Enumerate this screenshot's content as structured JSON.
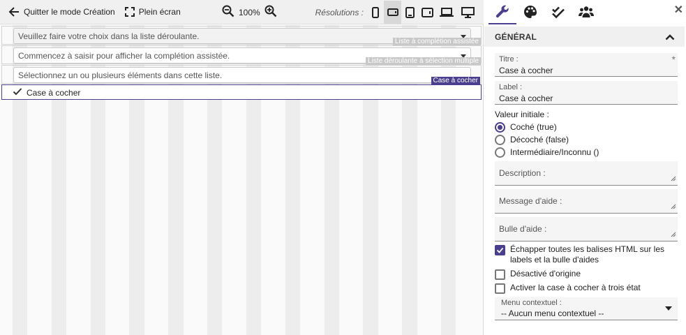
{
  "toolbar": {
    "quit_label": "Quitter le mode Création",
    "fullscreen_label": "Plein écran",
    "zoom_value": "100%",
    "resolutions_label": "Résolutions :"
  },
  "canvas": {
    "rows": [
      {
        "text": "Veuillez faire votre choix dans la liste déroulante.",
        "tag": "Liste à complétion assistée"
      },
      {
        "text": "Commencez à saisir pour afficher la complétion assistée.",
        "tag": "Liste déroulante à sélection multiple"
      },
      {
        "text": "Sélectionnez un ou plusieurs éléments dans cette liste.",
        "tag": ""
      }
    ],
    "checkbox": {
      "label": "Case à cocher",
      "tag": "Case à cocher",
      "checked": true
    }
  },
  "panel": {
    "section_title": "GÉNÉRAL",
    "title_field": {
      "label": "Titre :",
      "value": "Case à cocher",
      "required_mark": "*"
    },
    "label_field": {
      "label": "Label :",
      "value": "Case à cocher"
    },
    "initial_value_label": "Valeur initiale :",
    "radio_options": [
      "Coché (true)",
      "Décoché (false)",
      "Intermédiaire/Inconnu ()"
    ],
    "radio_selected": 0,
    "description_placeholder": "Description :",
    "help_message_placeholder": "Message d'aide :",
    "help_bubble_placeholder": "Bulle d'aide :",
    "checkboxes": {
      "escape_html": "Échapper toutes les balises HTML sur les labels et la bulle d'aides",
      "disabled_default": "Désactivé d'origine",
      "three_state": "Activer la case à cocher à trois état"
    },
    "context_menu": {
      "label": "Menu contextuel :",
      "value": "-- Aucun menu contextuel --"
    }
  },
  "colors": {
    "accent": "#4a3f8f",
    "stripe": "#ededed",
    "toolbar_bg": "#f0f0f0"
  },
  "icons": [
    "arrow-left-icon",
    "fullscreen-icon",
    "zoom-out-icon",
    "zoom-in-icon",
    "phone-icon",
    "phone-landscape-icon",
    "tablet-icon",
    "tablet-landscape-icon",
    "laptop-icon",
    "desktop-icon",
    "wrench-icon",
    "palette-icon",
    "double-check-icon",
    "users-icon",
    "close-icon",
    "chevron-up-icon"
  ]
}
